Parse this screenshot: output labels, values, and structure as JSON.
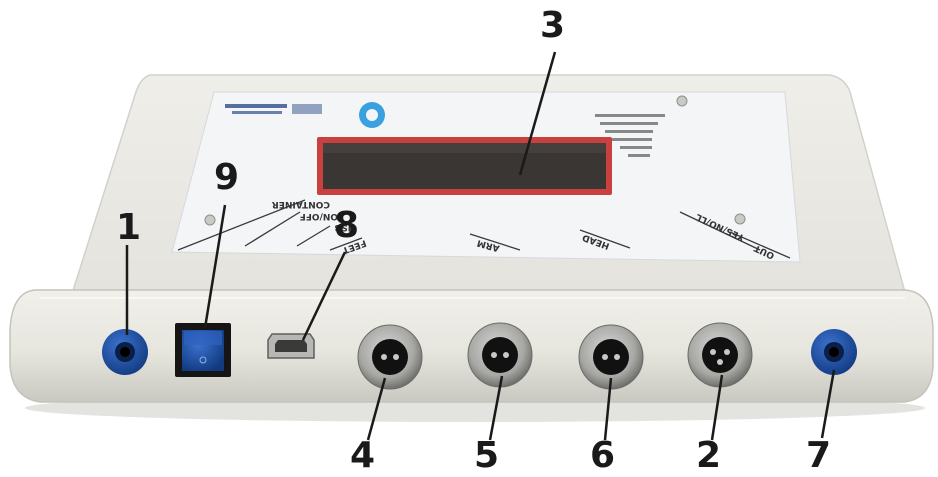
{
  "photo": {
    "panel_labels": {
      "container": "CONTAINER",
      "on_off": "ON/OFF",
      "usb": "USB",
      "feet": "FEET",
      "arm": "ARM",
      "head": "HEAD",
      "yes_no": "YES/NO/LL",
      "out": "OUT"
    },
    "callouts": [
      "1",
      "2",
      "3",
      "4",
      "5",
      "6",
      "7",
      "8",
      "9"
    ],
    "colors": {
      "housing": "#ecebe4",
      "panel": "#f2f4f6",
      "display_border": "#c8413e",
      "display": "#3a3633",
      "jack": "#1f4fa0",
      "switch": "#1e3c9a"
    }
  }
}
